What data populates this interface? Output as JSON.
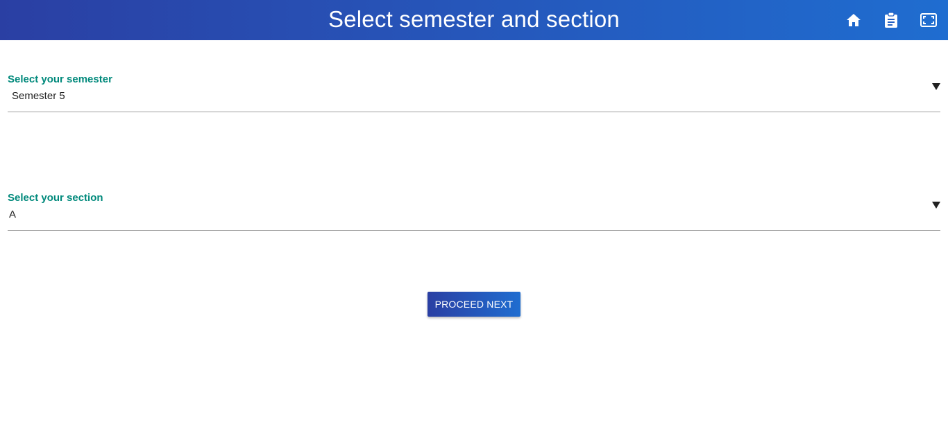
{
  "colors": {
    "header_gradient_start": "#2a3fa3",
    "header_gradient_end": "#1f6dd0",
    "label_color": "#00897b",
    "button_gradient_start": "#2a3fa3",
    "button_gradient_end": "#1f6dd0"
  },
  "header": {
    "title": "Select semester and section",
    "icons": [
      "home-icon",
      "clipboard-icon",
      "fullscreen-icon"
    ]
  },
  "semester": {
    "label": "Select your semester",
    "value": "Semester 5"
  },
  "section": {
    "label": "Select your section",
    "value": "A"
  },
  "actions": {
    "proceed_label": "PROCEED NEXT"
  }
}
